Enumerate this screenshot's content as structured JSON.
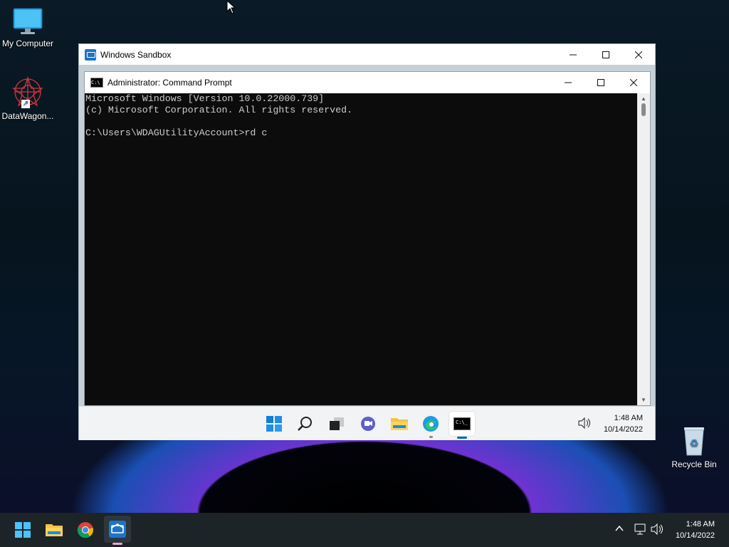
{
  "desktop": {
    "icons": [
      {
        "label": "My Computer",
        "icon": "monitor-icon"
      },
      {
        "label": "DataWagon...",
        "icon": "datawagon-icon"
      },
      {
        "label": "Recycle Bin",
        "icon": "recycle-bin-icon"
      }
    ]
  },
  "sandbox": {
    "title": "Windows Sandbox",
    "cmd": {
      "title": "Administrator: Command Prompt",
      "lines": [
        "Microsoft Windows [Version 10.0.22000.739]",
        "(c) Microsoft Corporation. All rights reserved.",
        "",
        "C:\\Users\\WDAGUtilityAccount>rd c"
      ]
    },
    "taskbar": {
      "apps": [
        "windows-start-icon",
        "search-icon",
        "task-view-icon",
        "chat-icon",
        "file-explorer-icon",
        "edge-icon",
        "command-prompt-icon"
      ],
      "time": "1:48 AM",
      "date": "10/14/2022"
    }
  },
  "taskbar": {
    "apps": [
      "windows-start-icon",
      "file-explorer-icon",
      "chrome-icon",
      "windows-sandbox-icon"
    ],
    "time": "1:48 AM",
    "date": "10/14/2022"
  },
  "colors": {
    "accent": "#0067c0",
    "cmd_bg": "#0c0c0c",
    "cmd_text": "#cccccc",
    "taskbar_dark": "#1c2428"
  }
}
